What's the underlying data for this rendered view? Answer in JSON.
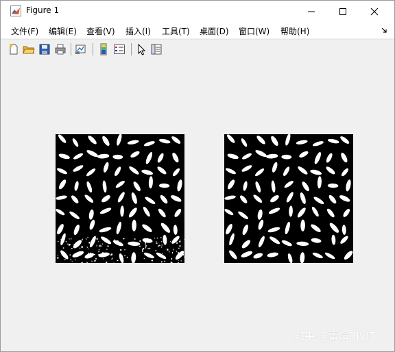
{
  "window": {
    "title": "Figure 1"
  },
  "menubar": {
    "items": [
      "文件(F)",
      "编辑(E)",
      "查看(V)",
      "插入(I)",
      "工具(T)",
      "桌面(D)",
      "窗口(W)",
      "帮助(H)"
    ]
  },
  "toolbar": {
    "tools": [
      "new-figure-icon",
      "open-file-icon",
      "save-icon",
      "print-icon",
      "link-plot-icon",
      "colorbar-icon",
      "legend-icon",
      "pointer-icon",
      "property-editor-icon"
    ]
  },
  "figure": {
    "image_1": "binary rice grains image (thresholded, noisy bottom)",
    "image_2": "binary rice grains image (cleaned)"
  },
  "watermark": {
    "text": "知乎 @雷娟RIVIT"
  },
  "colors": {
    "titlebar_bg": "#ffffff",
    "figure_bg": "#f0f0f0",
    "image_bg": "#000000",
    "grain": "#ffffff"
  }
}
